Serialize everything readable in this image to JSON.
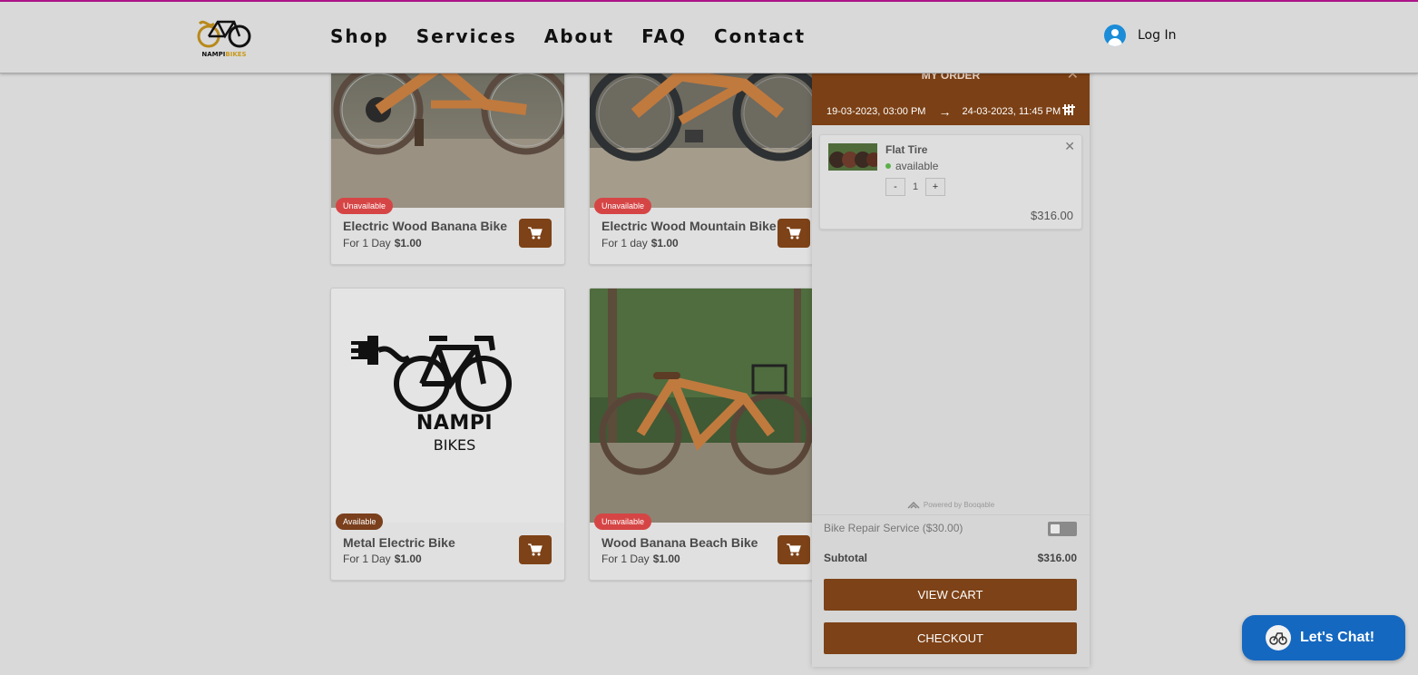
{
  "header": {
    "logo": {
      "brand_part1": "NAMPI",
      "brand_part2": "BIKES"
    },
    "nav": [
      "Shop",
      "Services",
      "About",
      "FAQ",
      "Contact"
    ],
    "login_label": "Log In"
  },
  "products": [
    {
      "status": "Unavailable",
      "title": "Electric Wood Banana Bike",
      "duration": "For 1 Day",
      "price": "$1.00"
    },
    {
      "status": "Unavailable",
      "title": "Electric Wood Mountain Bike",
      "duration": "For 1 day",
      "price": "$1.00"
    },
    {
      "status": "Available",
      "title": "Metal Electric Bike",
      "duration": "For 1 Day",
      "price": "$1.00",
      "logo_line1": "NAMPI",
      "logo_line2": "BIKES"
    },
    {
      "status": "Unavailable",
      "title": "Wood Banana Beach Bike",
      "duration": "For 1 Day",
      "price": "$1.00"
    }
  ],
  "order_panel": {
    "title": "MY ORDER",
    "start": "19-03-2023, 03:00 PM",
    "end": "24-03-2023, 11:45 PM",
    "item": {
      "name": "Flat Tire",
      "status": "available",
      "qty_minus": "-",
      "quantity": "1",
      "qty_plus": "+",
      "price": "$316.00"
    },
    "powered_by": "Powered by Booqable",
    "service_label": "Bike Repair Service ($30.00)",
    "service_enabled": false,
    "subtotal_label": "Subtotal",
    "subtotal_value": "$316.00",
    "view_cart_label": "VIEW CART",
    "checkout_label": "CHECKOUT"
  },
  "chat": {
    "label": "Let's Chat!"
  },
  "colors": {
    "accent_brown": "#7d4217",
    "unavailable_red": "#d64545",
    "chat_blue": "#1568c0",
    "top_line": "#b0158c"
  }
}
